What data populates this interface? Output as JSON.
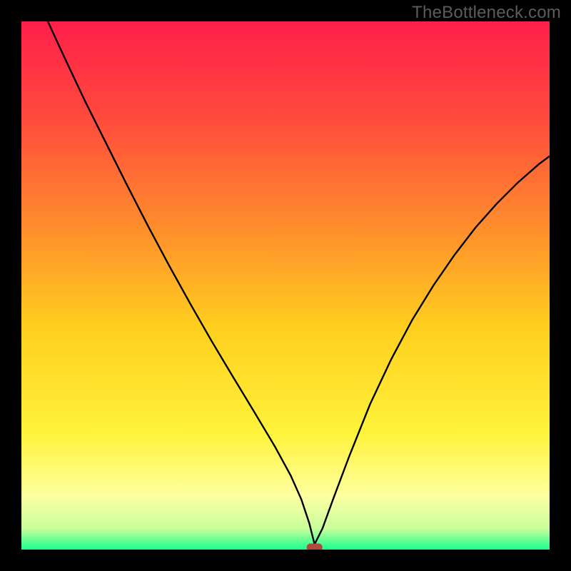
{
  "watermark": "TheBottleneck.com",
  "chart_data": {
    "type": "line",
    "title": "",
    "xlabel": "",
    "ylabel": "",
    "xlim": [
      0,
      1
    ],
    "ylim": [
      0,
      1
    ],
    "notes": "Background is a vertical red→orange→yellow→green gradient inside a black-bordered square. A single black curve descends steeply from the top-left, reaches a minimum near x≈0.55 at the bottom edge, then rises toward the right edge. A short red/brown marker sits at the curve minimum on the bottom edge.",
    "series": [
      {
        "name": "curve",
        "x": [
          0.05,
          0.08,
          0.12,
          0.16,
          0.2,
          0.24,
          0.28,
          0.32,
          0.36,
          0.4,
          0.44,
          0.48,
          0.51,
          0.53,
          0.545,
          0.555,
          0.57,
          0.59,
          0.62,
          0.66,
          0.7,
          0.74,
          0.78,
          0.82,
          0.86,
          0.9,
          0.94,
          0.98,
          1.0
        ],
        "y": [
          1.0,
          0.935,
          0.85,
          0.77,
          0.69,
          0.612,
          0.537,
          0.465,
          0.395,
          0.328,
          0.262,
          0.195,
          0.14,
          0.095,
          0.05,
          0.01,
          0.04,
          0.095,
          0.175,
          0.275,
          0.36,
          0.435,
          0.5,
          0.558,
          0.61,
          0.655,
          0.695,
          0.73,
          0.745
        ]
      }
    ],
    "marker": {
      "x": 0.555,
      "y": 0.004
    },
    "gradient_stops": [
      {
        "offset": 0.0,
        "color": "#ff1f4a"
      },
      {
        "offset": 0.18,
        "color": "#ff4a3d"
      },
      {
        "offset": 0.38,
        "color": "#ff8a2d"
      },
      {
        "offset": 0.58,
        "color": "#ffcf1f"
      },
      {
        "offset": 0.78,
        "color": "#fff33a"
      },
      {
        "offset": 0.9,
        "color": "#fdffa2"
      },
      {
        "offset": 0.96,
        "color": "#c8ff9c"
      },
      {
        "offset": 1.0,
        "color": "#19ff8c"
      }
    ],
    "frame": {
      "stroke": "#000000",
      "stroke_width": 30
    }
  }
}
